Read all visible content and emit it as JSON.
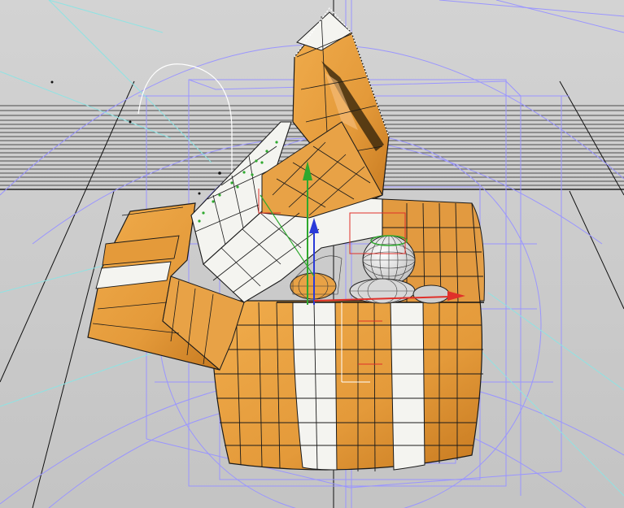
{
  "viewport": {
    "name": "3d-modeling-perspective-viewport",
    "background_top": "#d3d3d3",
    "background_bottom": "#c4c4c4",
    "grid_color": "#111111",
    "wireframe_color": "#9a95ff",
    "cyan_guide_color": "#8fe3e3",
    "mesh_orange": "#e49a3a",
    "mesh_orange_dark": "#c77a20",
    "mesh_white": "#f4f4f0",
    "mesh_edge": "#1a1a1a",
    "gizmo": {
      "x_axis_color": "#e0302a",
      "y_axis_color": "#2ea82e",
      "z_axis_color": "#2a3ad8"
    }
  }
}
